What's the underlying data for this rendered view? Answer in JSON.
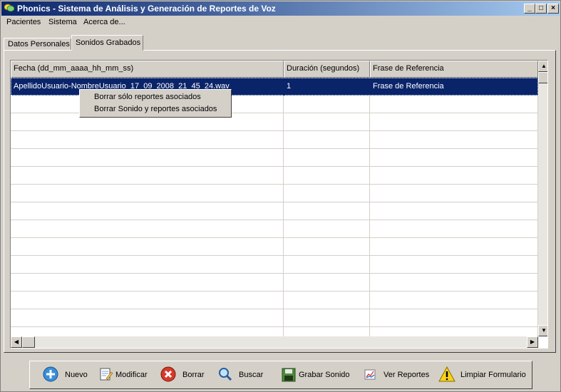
{
  "window": {
    "title": "Phonics - Sistema de Análisis y Generación de Reportes de Voz"
  },
  "menu": [
    "Pacientes",
    "Sistema",
    "Acerca de..."
  ],
  "tabs": [
    {
      "label": "Datos Personales",
      "active": false
    },
    {
      "label": "Sonidos Grabados",
      "active": true
    }
  ],
  "grid": {
    "columns": [
      "Fecha (dd_mm_aaaa_hh_mm_ss)",
      "Duración (segundos)",
      "Frase de Referencia"
    ],
    "rows": [
      [
        "ApellidoUsuario-NombreUsuario_17_09_2008_21_45_24.wav",
        "1",
        "Frase de Referencia"
      ]
    ]
  },
  "context_menu": {
    "items": [
      "Borrar sólo reportes asociados",
      "Borrar Sonido y reportes asociados"
    ]
  },
  "toolbar": {
    "nuevo": "Nuevo",
    "modificar": "Modificar",
    "borrar": "Borrar",
    "buscar": "Buscar",
    "grabar": "Grabar Sonido",
    "ver_reportes": "Ver Reportes",
    "limpiar": "Limpiar Formulario"
  },
  "colors": {
    "selection": "#0a246a",
    "titlebar": "#0a246a",
    "face": "#d4d0c8"
  }
}
